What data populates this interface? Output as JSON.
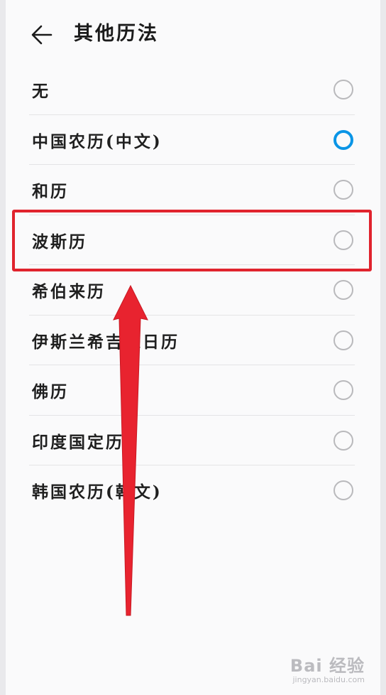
{
  "header": {
    "title": "其他历法",
    "back_icon": "arrow-left-icon"
  },
  "calendars": [
    {
      "label": "无",
      "selected": false
    },
    {
      "label": "中国农历(中文)",
      "selected": true
    },
    {
      "label": "和历",
      "selected": false
    },
    {
      "label": "波斯历",
      "selected": false
    },
    {
      "label": "希伯来历",
      "selected": false
    },
    {
      "label": "伊斯兰希吉来日历",
      "selected": false
    },
    {
      "label": "佛历",
      "selected": false
    },
    {
      "label": "印度国定历",
      "selected": false
    },
    {
      "label": "韩国农历(韩文)",
      "selected": false
    }
  ],
  "colors": {
    "accent": "#0a95e6",
    "annotation": "#e0232d"
  },
  "watermark": {
    "main": "Bai 经验",
    "sub": "jingyan.baidu.com"
  }
}
